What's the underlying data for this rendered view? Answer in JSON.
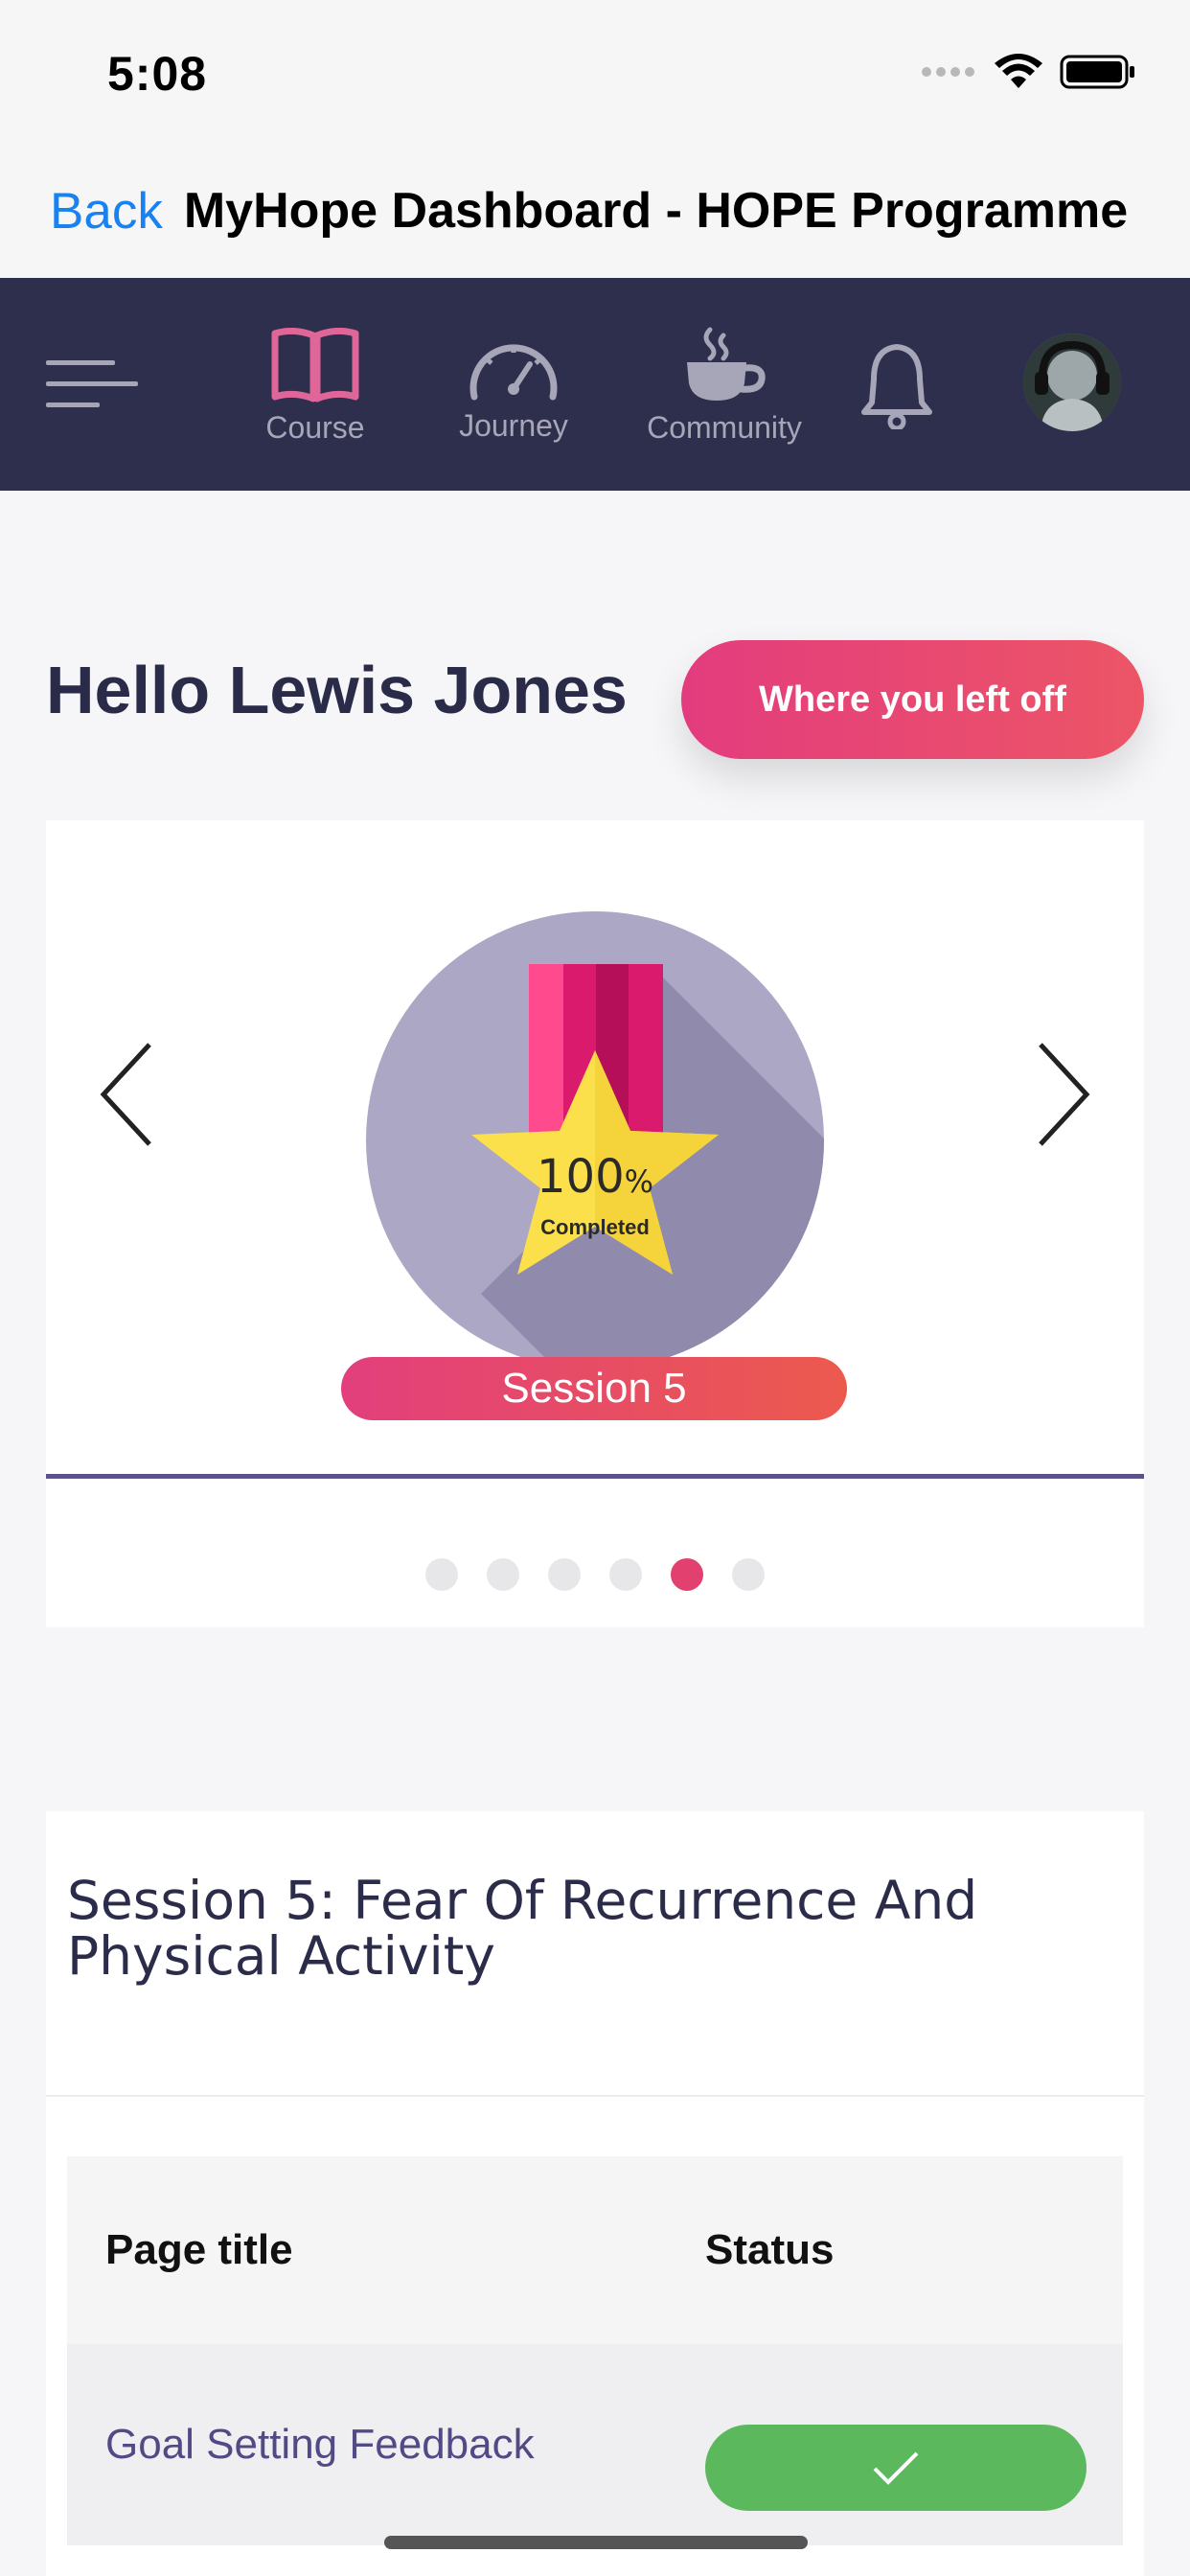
{
  "status_bar": {
    "time": "5:08"
  },
  "web_header": {
    "back_label": "Back",
    "title": "MyHope Dashboard - HOPE Programme"
  },
  "nav": {
    "items": [
      {
        "label": "Course",
        "icon": "book-icon",
        "active": true
      },
      {
        "label": "Journey",
        "icon": "speedometer-icon",
        "active": false
      },
      {
        "label": "Community",
        "icon": "coffee-cup-icon",
        "active": false
      }
    ]
  },
  "greeting": "Hello Lewis Jones",
  "left_off_button": "Where you left off",
  "carousel": {
    "badge_percent": "100",
    "badge_percent_symbol": "%",
    "badge_caption": "Completed",
    "session_label": "Session 5",
    "total_slides": 6,
    "active_slide": 5
  },
  "session_card": {
    "title": "Session 5: Fear Of Recurrence And Physical Activity",
    "table": {
      "headers": [
        "Page title",
        "Status"
      ],
      "rows": [
        {
          "page_title": "Goal Setting Feedback",
          "status": "completed"
        }
      ]
    }
  },
  "colors": {
    "nav_background": "#2e2f4d",
    "accent_pink": "#e33c7e",
    "link_blue": "#1a82f0",
    "success_green": "#5cb85c"
  }
}
